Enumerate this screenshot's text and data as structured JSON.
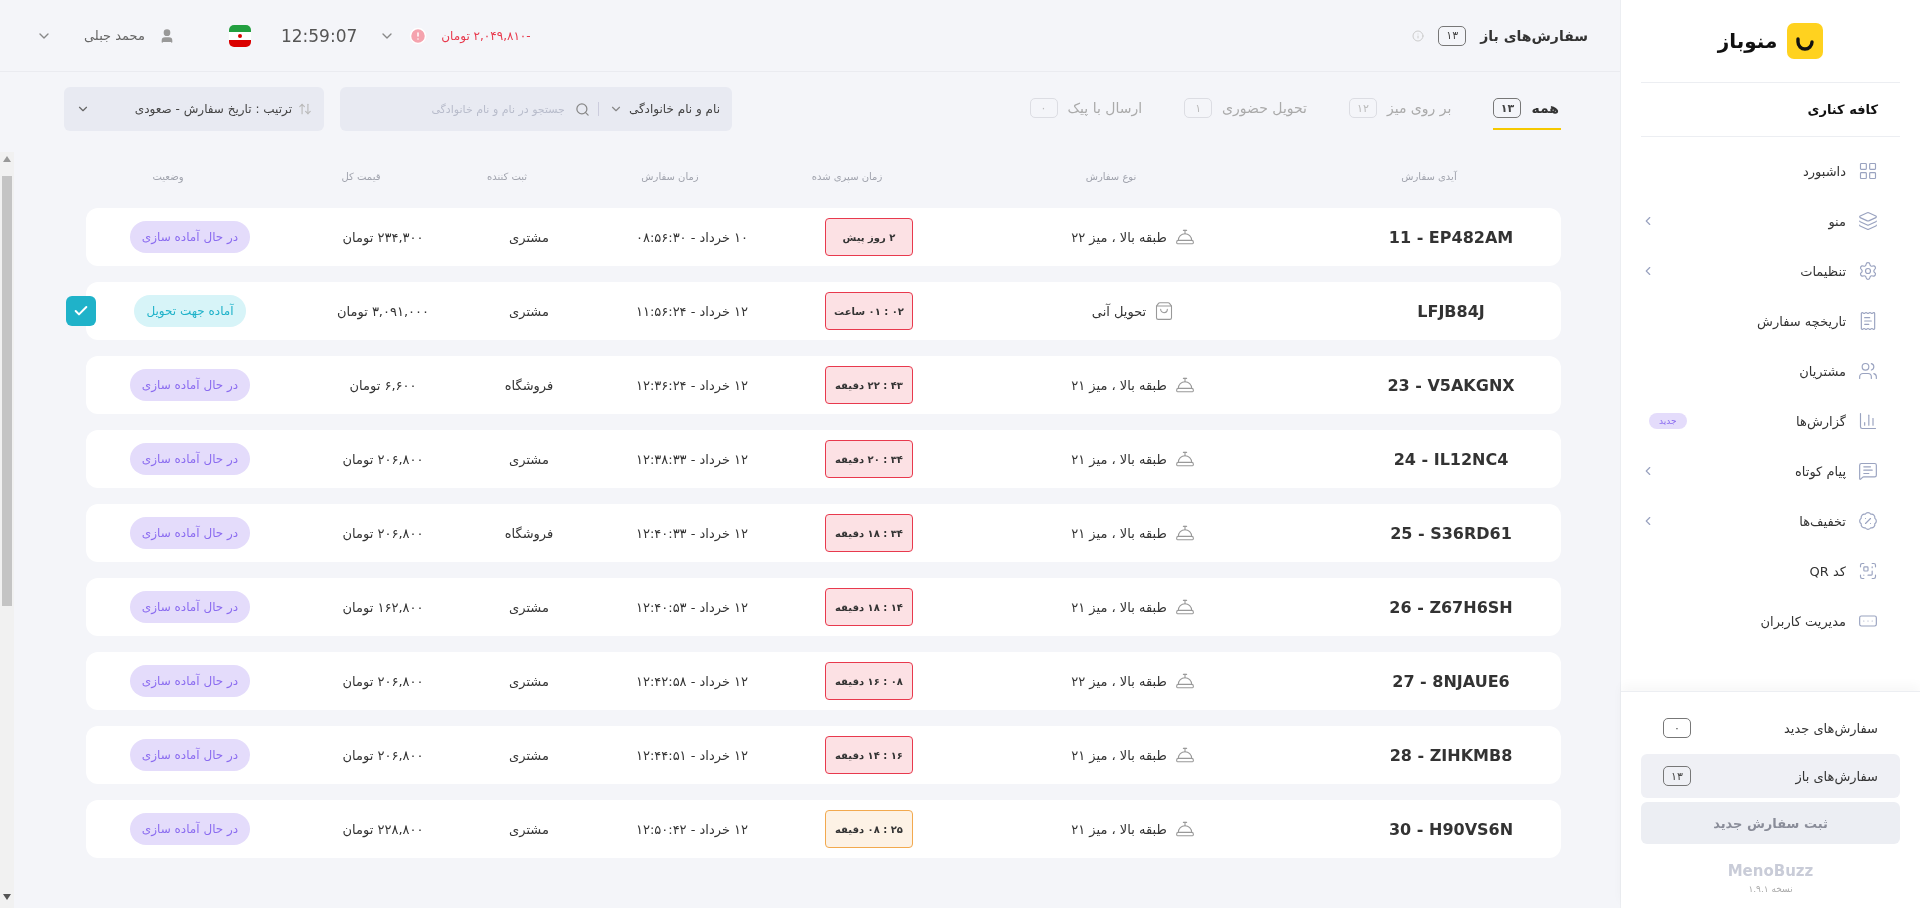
{
  "top_bar": {
    "title": "سفارش‌های باز",
    "count": "۱۳",
    "balance": "-۲,۰۴۹,۸۱۰ تومان",
    "time": "12:59:07",
    "user": "محمد جبلی"
  },
  "tabs": [
    {
      "label": "همه",
      "count": "۱۳",
      "selected": true
    },
    {
      "label": "بر روی میز",
      "count": "۱۲",
      "selected": false
    },
    {
      "label": "تحویل حضوری",
      "count": "۱",
      "selected": false
    },
    {
      "label": "ارسال با پیک",
      "count": "۰",
      "selected": false
    }
  ],
  "search": {
    "field_select": "نام و نام خانوادگی",
    "placeholder": "جستجو در نام و نام خانوادگی"
  },
  "sort": {
    "label": "ترتیب : تاریخ سفارش - صعودی"
  },
  "table": {
    "columns": [
      "آیدی سفارش",
      "نوع سفارش",
      "زمان سپری شده",
      "زمان سفارش",
      "ثبت کننده",
      "قیمت کل",
      "وضعیت"
    ],
    "rows": [
      {
        "id": "11 - EP482AM",
        "order_type": {
          "kind": "dine_in",
          "label": "طبقه بالا ، میز ۲۲"
        },
        "elapsed": {
          "text": "۲ روز پیش",
          "color": "#e8394d"
        },
        "order_time": "۱۰ خرداد - ۰۸:۵۶:۳۰",
        "registrar": "مشتری",
        "price": "۲۳۴,۳۰۰ تومان",
        "status": {
          "kind": "preparing",
          "label": "در حال آماده سازی"
        },
        "checked": false
      },
      {
        "id": "LFJB84J",
        "order_type": {
          "kind": "takeaway",
          "label": "تحویل آنی"
        },
        "elapsed": {
          "text": "۰۲ : ۰۱ ساعت",
          "color": "#e8394d"
        },
        "order_time": "۱۲ خرداد - ۱۱:۵۶:۲۴",
        "registrar": "مشتری",
        "price": "۳,۰۹۱,۰۰۰ تومان",
        "status": {
          "kind": "ready",
          "label": "آماده جهت تحویل"
        },
        "checked": true
      },
      {
        "id": "23 - V5AKGNX",
        "order_type": {
          "kind": "dine_in",
          "label": "طبقه بالا ، میز ۲۱"
        },
        "elapsed": {
          "text": "۴۳ : ۲۲ دقیقه",
          "color": "#e8394d"
        },
        "order_time": "۱۲ خرداد - ۱۲:۳۶:۲۴",
        "registrar": "فروشگاه",
        "price": "۶,۶۰۰ تومان",
        "status": {
          "kind": "preparing",
          "label": "در حال آماده سازی"
        },
        "checked": false
      },
      {
        "id": "24 - IL12NC4",
        "order_type": {
          "kind": "dine_in",
          "label": "طبقه بالا ، میز ۲۱"
        },
        "elapsed": {
          "text": "۳۴ : ۲۰ دقیقه",
          "color": "#e8394d"
        },
        "order_time": "۱۲ خرداد - ۱۲:۳۸:۳۳",
        "registrar": "مشتری",
        "price": "۲۰۶,۸۰۰ تومان",
        "status": {
          "kind": "preparing",
          "label": "در حال آماده سازی"
        },
        "checked": false
      },
      {
        "id": "25 - S36RD61",
        "order_type": {
          "kind": "dine_in",
          "label": "طبقه بالا ، میز ۲۱"
        },
        "elapsed": {
          "text": "۳۴ : ۱۸ دقیقه",
          "color": "#e8394d"
        },
        "order_time": "۱۲ خرداد - ۱۲:۴۰:۳۳",
        "registrar": "فروشگاه",
        "price": "۲۰۶,۸۰۰ تومان",
        "status": {
          "kind": "preparing",
          "label": "در حال آماده سازی"
        },
        "checked": false
      },
      {
        "id": "26 - Z67H6SH",
        "order_type": {
          "kind": "dine_in",
          "label": "طبقه بالا ، میز ۲۱"
        },
        "elapsed": {
          "text": "۱۴ : ۱۸ دقیقه",
          "color": "#e8394d"
        },
        "order_time": "۱۲ خرداد - ۱۲:۴۰:۵۳",
        "registrar": "مشتری",
        "price": "۱۶۲,۸۰۰ تومان",
        "status": {
          "kind": "preparing",
          "label": "در حال آماده سازی"
        },
        "checked": false
      },
      {
        "id": "27 - 8NJAUE6",
        "order_type": {
          "kind": "dine_in",
          "label": "طبقه بالا ، میز ۲۲"
        },
        "elapsed": {
          "text": "۰۸ : ۱۶ دقیقه",
          "color": "#e8394d"
        },
        "order_time": "۱۲ خرداد - ۱۲:۴۲:۵۸",
        "registrar": "مشتری",
        "price": "۲۰۶,۸۰۰ تومان",
        "status": {
          "kind": "preparing",
          "label": "در حال آماده سازی"
        },
        "checked": false
      },
      {
        "id": "28 - ZIHKMB8",
        "order_type": {
          "kind": "dine_in",
          "label": "طبقه بالا ، میز ۲۱"
        },
        "elapsed": {
          "text": "۱۶ : ۱۴ دقیقه",
          "color": "#e8394d"
        },
        "order_time": "۱۲ خرداد - ۱۲:۴۴:۵۱",
        "registrar": "مشتری",
        "price": "۲۰۶,۸۰۰ تومان",
        "status": {
          "kind": "preparing",
          "label": "در حال آماده سازی"
        },
        "checked": false
      },
      {
        "id": "30 - H90VS6N",
        "order_type": {
          "kind": "dine_in",
          "label": "طبقه بالا ، میز ۲۱"
        },
        "elapsed": {
          "text": "۲۵ : ۰۸ دقیقه",
          "color": "#f2a94e"
        },
        "order_time": "۱۲ خرداد - ۱۲:۵۰:۴۲",
        "registrar": "مشتری",
        "price": "۲۲۸,۸۰۰ تومان",
        "status": {
          "kind": "preparing",
          "label": "در حال آماده سازی"
        },
        "checked": false
      }
    ]
  },
  "sidebar": {
    "logo_text": "منوباز",
    "venue": "کافه کناری",
    "items": [
      {
        "label": "داشبورد",
        "submenu": false
      },
      {
        "label": "منو",
        "submenu": true
      },
      {
        "label": "تنظیمات",
        "submenu": true
      },
      {
        "label": "تاریخچه سفارش",
        "submenu": false
      },
      {
        "label": "مشتریان",
        "submenu": false
      },
      {
        "label": "گزارش‌ها",
        "submenu": false,
        "badge": "جدید"
      },
      {
        "label": "پیام کوتاه",
        "submenu": true
      },
      {
        "label": "تخفیف‌ها",
        "submenu": true
      },
      {
        "label": "کد QR",
        "submenu": false
      },
      {
        "label": "مدیریت کاربران",
        "submenu": false
      }
    ],
    "order_links": [
      {
        "label": "سفارش‌های جدید",
        "count": "۰",
        "selected": false
      },
      {
        "label": "سفارش‌های باز",
        "count": "۱۳",
        "selected": true
      }
    ],
    "new_order_button": {
      "label": "ثبت سفارش جدید",
      "disabled": true
    },
    "brand": "MenoBuzz",
    "version": "نسخه ۱.۹.۱"
  }
}
